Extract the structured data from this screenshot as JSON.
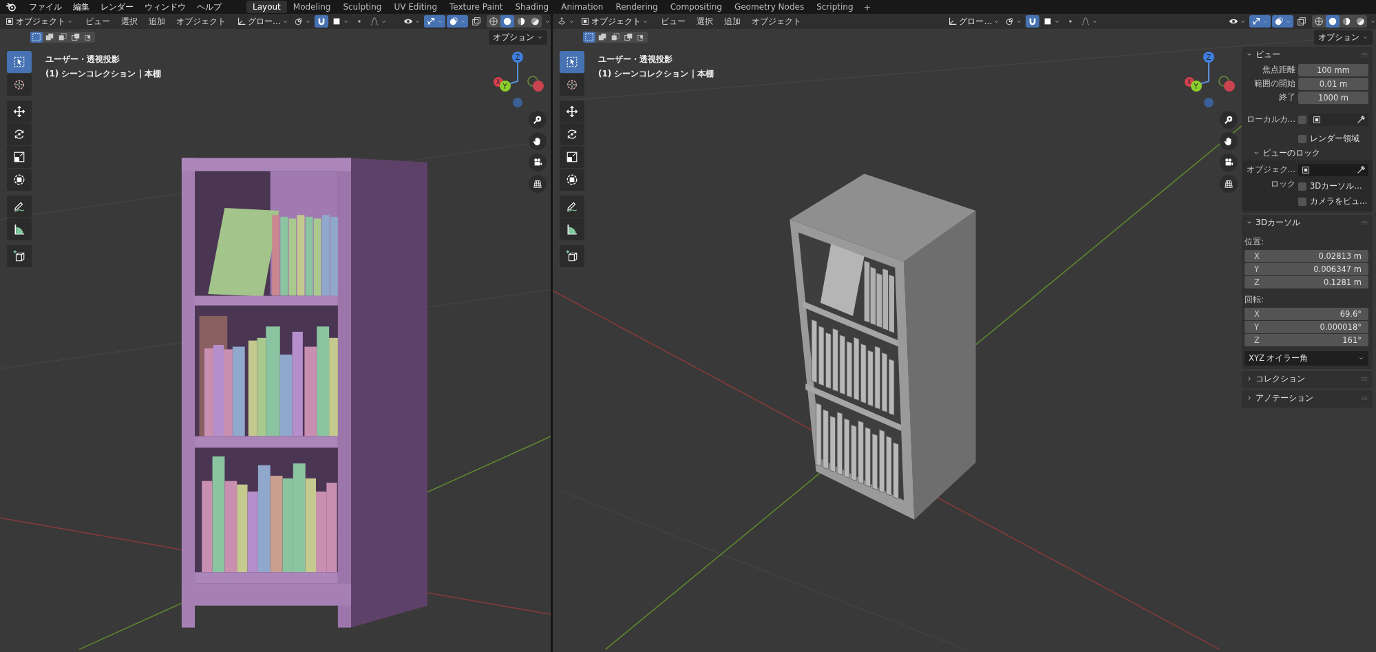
{
  "top_bar": {
    "menus": [
      "ファイル",
      "編集",
      "レンダー",
      "ウィンドウ",
      "ヘルプ"
    ],
    "workspaces": [
      {
        "label": "Layout",
        "selected": true
      },
      {
        "label": "Modeling",
        "selected": false
      },
      {
        "label": "Sculpting",
        "selected": false
      },
      {
        "label": "UV Editing",
        "selected": false
      },
      {
        "label": "Texture Paint",
        "selected": false
      },
      {
        "label": "Shading",
        "selected": false
      },
      {
        "label": "Animation",
        "selected": false
      },
      {
        "label": "Rendering",
        "selected": false
      },
      {
        "label": "Compositing",
        "selected": false
      },
      {
        "label": "Geometry Nodes",
        "selected": false
      },
      {
        "label": "Scripting",
        "selected": false
      }
    ],
    "add_workspace": "+"
  },
  "viewports": [
    {
      "header": {
        "editor_type_button": false,
        "mode": "オブジェクト",
        "menus": [
          "ビュー",
          "選択",
          "追加",
          "オブジェクト"
        ],
        "orientation": "グロー…",
        "snap_on": true,
        "gizmos_on": true,
        "overlays_on": true,
        "shading": [
          {
            "selected": false
          },
          {
            "selected": true
          },
          {
            "selected": false
          },
          {
            "selected": false
          }
        ]
      },
      "select_modes": [
        {
          "selected": true
        },
        {
          "selected": false
        },
        {
          "selected": false
        },
        {
          "selected": false
        },
        {
          "selected": false
        }
      ],
      "options": "オプション",
      "tools": [
        {
          "selected": true
        },
        {
          "selected": false
        },
        {
          "selected": false
        },
        {
          "selected": false
        },
        {
          "selected": false
        },
        {
          "selected": false
        },
        {
          "selected": false
        },
        {
          "selected": false
        },
        {
          "selected": false
        }
      ],
      "info": [
        "ユーザー・透視投影",
        "(1) シーンコレクション | 本棚"
      ],
      "gizmo_labels": [
        "Z",
        "Y",
        "X"
      ],
      "model": {
        "kind": "colored"
      }
    },
    {
      "header": {
        "editor_type_button": true,
        "mode": "オブジェクト",
        "menus": [
          "ビュー",
          "選択",
          "追加",
          "オブジェクト"
        ],
        "orientation": "グロー…",
        "snap_on": true,
        "gizmos_on": true,
        "overlays_on": true,
        "shading": [
          {
            "selected": false
          },
          {
            "selected": true
          },
          {
            "selected": false
          },
          {
            "selected": false
          }
        ]
      },
      "select_modes": [
        {
          "selected": true
        },
        {
          "selected": false
        },
        {
          "selected": false
        },
        {
          "selected": false
        },
        {
          "selected": false
        }
      ],
      "options": "オプション",
      "tools": [
        {
          "selected": true
        },
        {
          "selected": false
        },
        {
          "selected": false
        },
        {
          "selected": false
        },
        {
          "selected": false
        },
        {
          "selected": false
        },
        {
          "selected": false
        },
        {
          "selected": false
        },
        {
          "selected": false
        }
      ],
      "info": [
        "ユーザー・透視投影",
        "(1) シーンコレクション | 本棚"
      ],
      "gizmo_labels": [
        "Z",
        "Y",
        "X"
      ],
      "model": {
        "kind": "plain"
      },
      "sidebar": {
        "panels": [
          {
            "title": "ビュー",
            "expanded": true,
            "rows": [
              {
                "kind": "number",
                "label": "焦点距離",
                "value": "100 mm"
              },
              {
                "kind": "number",
                "label": "範囲の開始",
                "value": "0.01 m"
              },
              {
                "kind": "number",
                "label": "終了",
                "value": "1000 m"
              },
              {
                "kind": "local",
                "label": "ローカルカ…",
                "checked": false
              },
              {
                "kind": "check",
                "text": "レンダー領域",
                "checked": false
              }
            ],
            "subpanels": [
              {
                "title": "ビューのロック",
                "expanded": true,
                "rows": [
                  {
                    "kind": "object",
                    "label": "オブジェク…"
                  },
                  {
                    "kind": "check",
                    "label": "ロック",
                    "text": "3Dカーソル…",
                    "checked": false
                  },
                  {
                    "kind": "check",
                    "text": "カメラをビュ…",
                    "checked": false
                  }
                ]
              }
            ]
          },
          {
            "title": "3Dカーソル",
            "expanded": true,
            "rows": [
              {
                "kind": "heading",
                "text": "位置:"
              },
              {
                "kind": "vector",
                "items": [
                  {
                    "axis": "X",
                    "value": "0.02813 m"
                  },
                  {
                    "axis": "Y",
                    "value": "0.006347 m"
                  },
                  {
                    "axis": "Z",
                    "value": "0.1281 m"
                  }
                ]
              },
              {
                "kind": "heading",
                "text": "回転:"
              },
              {
                "kind": "vector",
                "items": [
                  {
                    "axis": "X",
                    "value": "69.6°"
                  },
                  {
                    "axis": "Y",
                    "value": "0.000018°"
                  },
                  {
                    "axis": "Z",
                    "value": "161°"
                  }
                ]
              },
              {
                "kind": "dropdown",
                "value": "XYZ オイラー角"
              }
            ]
          },
          {
            "title": "コレクション",
            "expanded": false
          },
          {
            "title": "アノテーション",
            "expanded": false
          }
        ]
      }
    }
  ]
}
